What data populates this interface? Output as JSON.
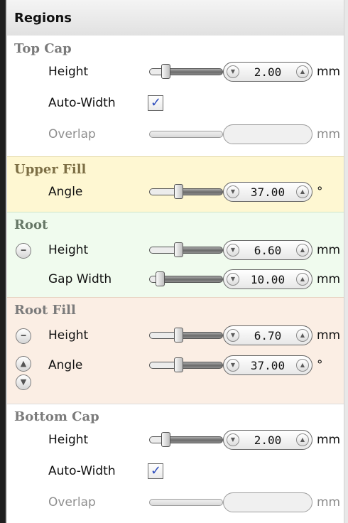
{
  "panel": {
    "title": "Regions"
  },
  "sections": {
    "top_cap": {
      "title": "Top Cap",
      "height": {
        "label": "Height",
        "value": "2.00",
        "unit": "mm"
      },
      "auto_width": {
        "label": "Auto-Width",
        "checked": true
      },
      "overlap": {
        "label": "Overlap",
        "value": "",
        "unit": "mm",
        "disabled": true
      }
    },
    "upper_fill": {
      "title": "Upper Fill",
      "angle": {
        "label": "Angle",
        "value": "37.00",
        "unit": "°"
      }
    },
    "root": {
      "title": "Root",
      "height": {
        "label": "Height",
        "value": "6.60",
        "unit": "mm"
      },
      "gap_width": {
        "label": "Gap Width",
        "value": "10.00",
        "unit": "mm"
      }
    },
    "root_fill": {
      "title": "Root Fill",
      "height": {
        "label": "Height",
        "value": "6.70",
        "unit": "mm"
      },
      "angle": {
        "label": "Angle",
        "value": "37.00",
        "unit": "°"
      }
    },
    "bottom_cap": {
      "title": "Bottom Cap",
      "height": {
        "label": "Height",
        "value": "2.00",
        "unit": "mm"
      },
      "auto_width": {
        "label": "Auto-Width",
        "checked": true
      },
      "overlap": {
        "label": "Overlap",
        "value": "",
        "unit": "mm",
        "disabled": true
      }
    }
  },
  "icons": {
    "collapse": "minus-circle-icon",
    "move_up": "arrow-up-circle-icon",
    "move_down": "arrow-down-circle-icon",
    "spin_down": "triangle-down-icon",
    "spin_up": "triangle-up-icon",
    "check": "checkmark-icon"
  },
  "colors": {
    "upper_fill_bg": "#fef7d2",
    "root_bg": "#f0fbee",
    "root_fill_bg": "#fbeee4",
    "checkbox_mark": "#2b4bbd"
  }
}
